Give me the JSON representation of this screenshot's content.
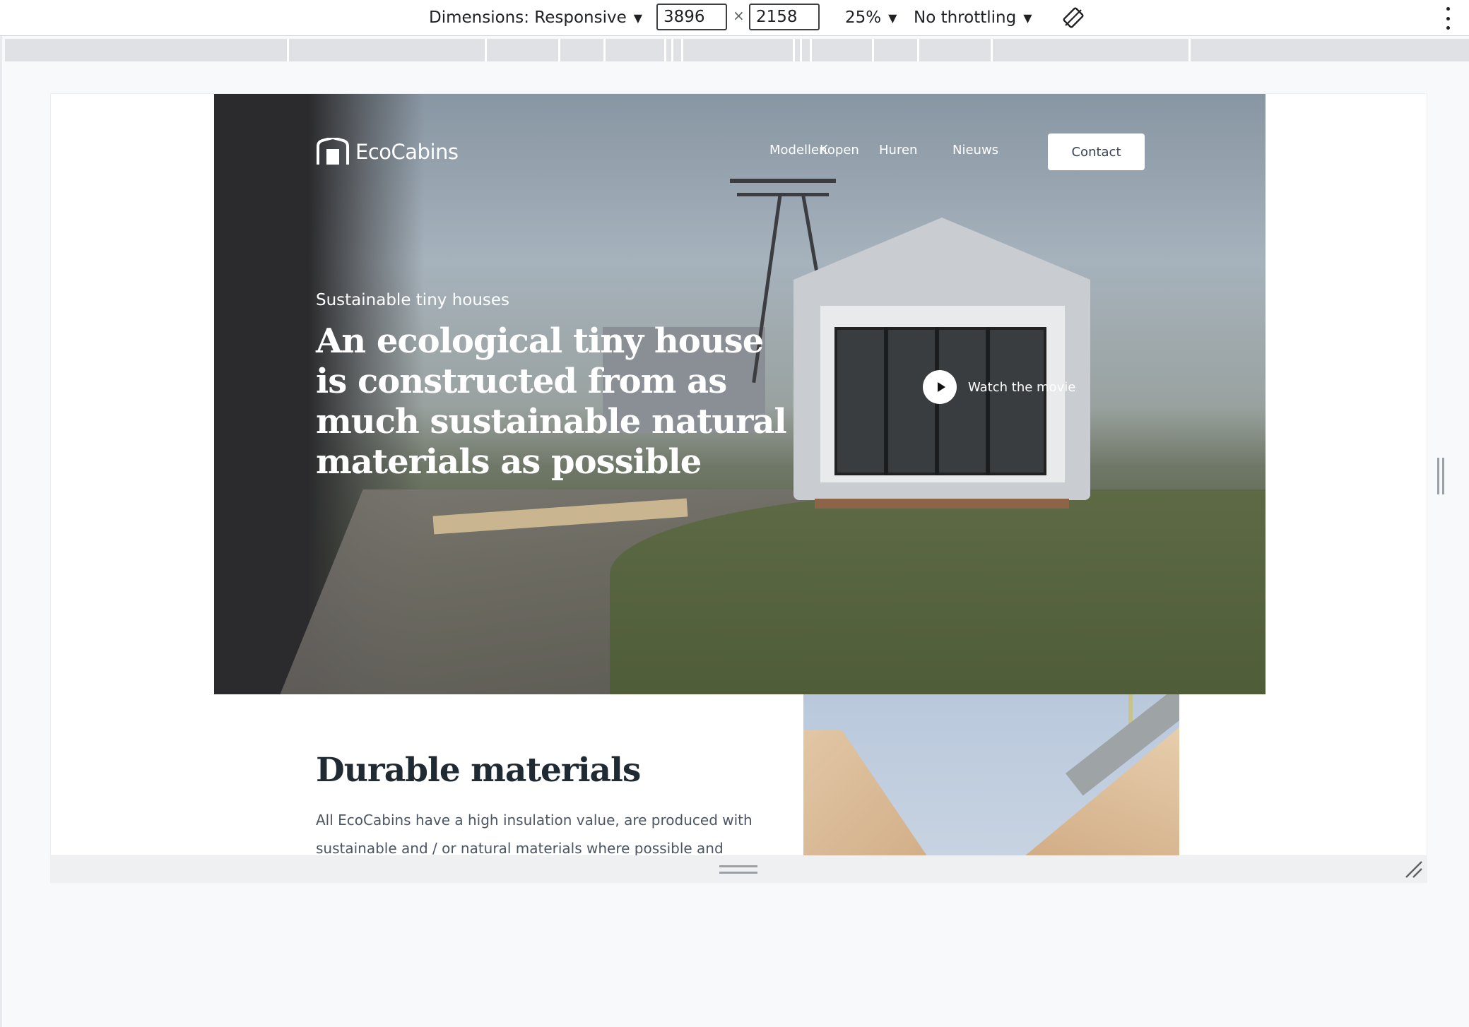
{
  "devtools": {
    "dimensions_label": "Dimensions: Responsive",
    "width_value": "3896",
    "times": "×",
    "height_value": "2158",
    "zoom": "25%",
    "throttling": "No throttling",
    "caret": "▼"
  },
  "site": {
    "logo_text": "EcoCabins",
    "nav": {
      "items": [
        "Modellen",
        "Kopen",
        "Huren",
        "Nieuws"
      ],
      "contact": "Contact"
    },
    "hero": {
      "kicker": "Sustainable tiny houses",
      "title": "An ecological tiny house is constructed from as much sustainable natural materials as possible",
      "watch_label": "Watch the movie"
    },
    "section": {
      "title": "Durable materials",
      "text": "All EcoCabins have a high insulation value, are produced with sustainable and / or natural materials where possible and"
    }
  }
}
